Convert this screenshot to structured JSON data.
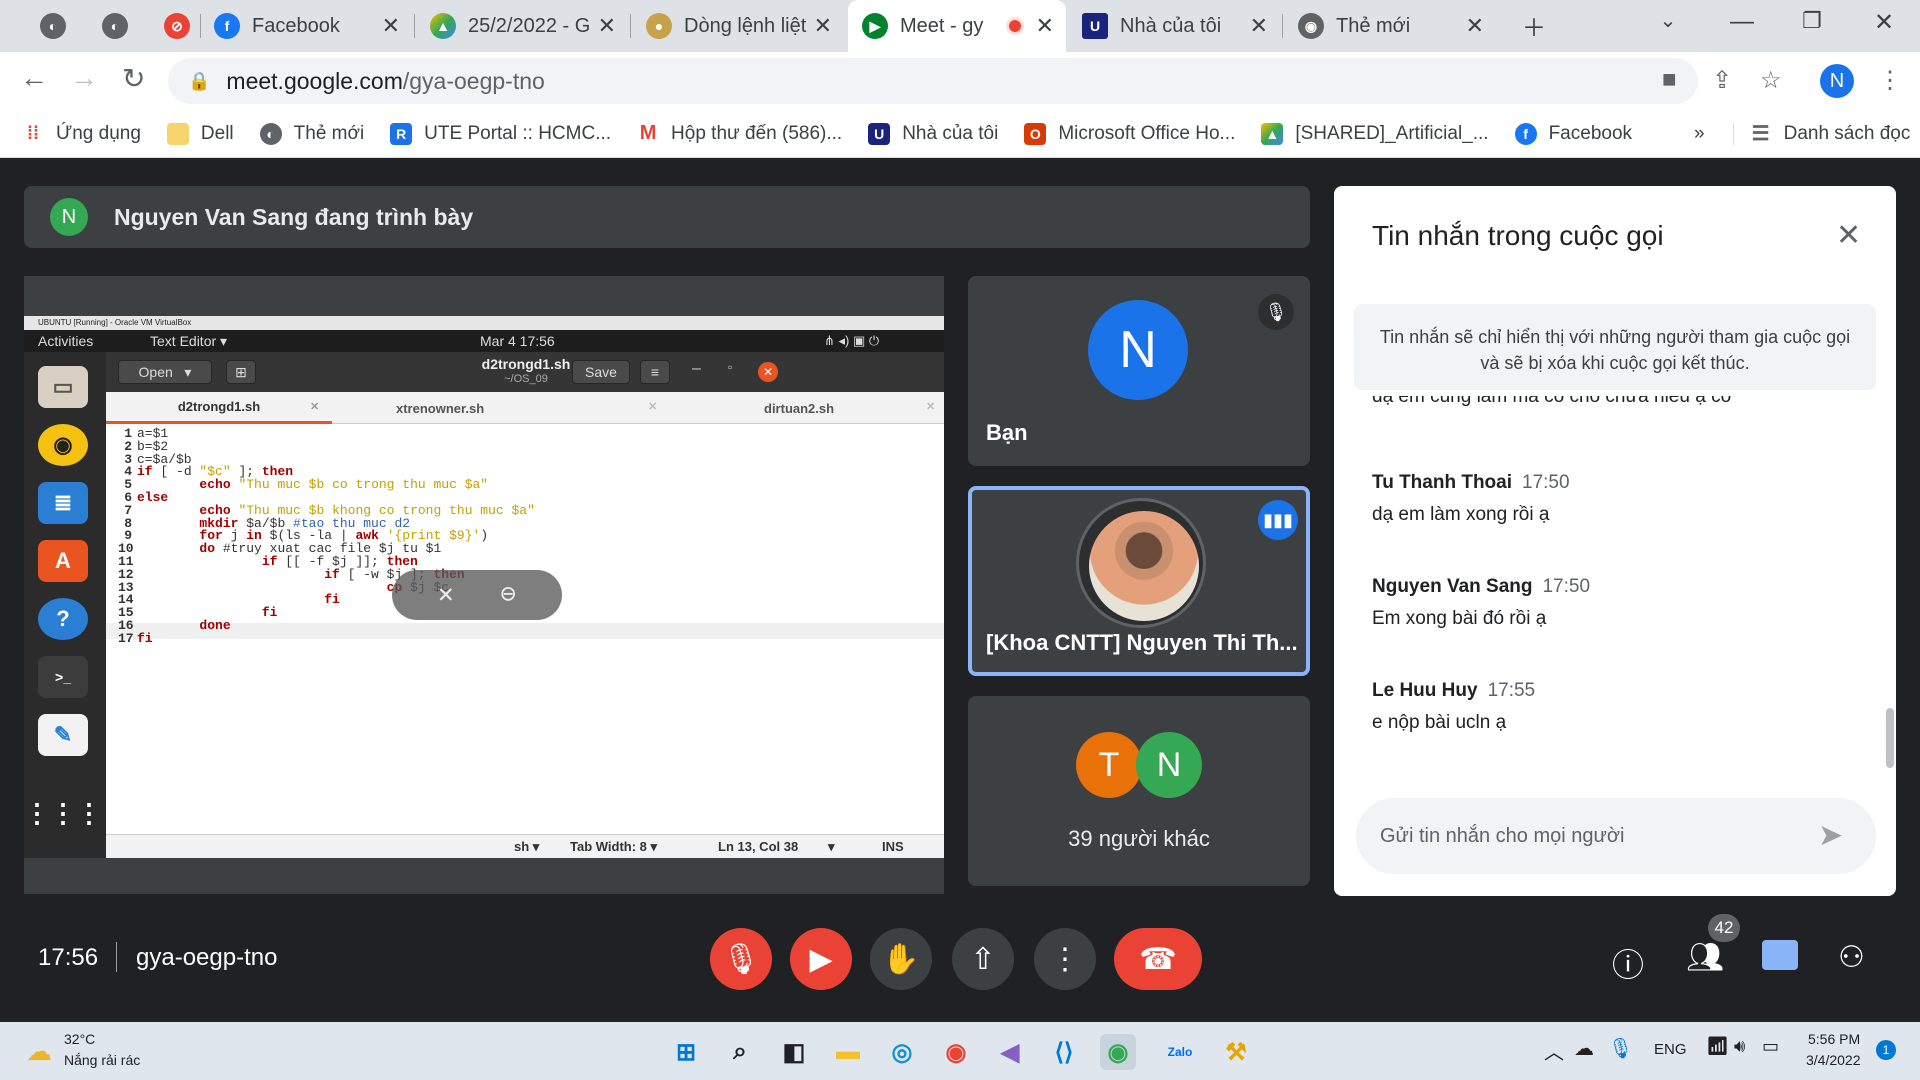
{
  "browser": {
    "tabs": [
      {
        "label": "Facebook",
        "icon": "facebook-icon"
      },
      {
        "label": "25/2/2022 - G",
        "icon": "google-drive-icon"
      },
      {
        "label": "Dòng lệnh liệt",
        "icon": "site-icon"
      },
      {
        "label": "Meet - gy",
        "icon": "google-meet-icon",
        "active": true
      },
      {
        "label": "Nhà của tôi",
        "icon": "uex-icon"
      },
      {
        "label": "Thẻ mới",
        "icon": "chrome-icon"
      }
    ],
    "url_host": "meet.google.com",
    "url_path": "/gya-oegp-tno",
    "profile_initial": "N",
    "bookmarks": [
      {
        "label": "Ứng dụng",
        "icon": "apps-grid-icon"
      },
      {
        "label": "Dell",
        "icon": "folder-icon"
      },
      {
        "label": "Thẻ mới",
        "icon": "globe-icon"
      },
      {
        "label": "UTE Portal :: HCMC...",
        "icon": "ute-icon"
      },
      {
        "label": "Hộp thư đến (586)...",
        "icon": "gmail-icon"
      },
      {
        "label": "Nhà của tôi",
        "icon": "uex-icon"
      },
      {
        "label": "Microsoft Office Ho...",
        "icon": "office-icon"
      },
      {
        "label": "[SHARED]_Artificial_...",
        "icon": "google-drive-icon"
      },
      {
        "label": "Facebook",
        "icon": "facebook-icon"
      }
    ],
    "bookmarks_more": "»",
    "reading_list": "Danh sách đọc"
  },
  "meet": {
    "presenter_initial": "N",
    "presenter_text": "Nguyen Van Sang đang trình bày",
    "participants": {
      "you_initial": "N",
      "you_label": "Bạn",
      "speaker_label": "[Khoa CNTT] Nguyen Thi Th...",
      "others_initials": [
        "T",
        "N"
      ],
      "others_label": "39 người khác"
    },
    "time": "17:56",
    "meeting_code": "gya-oegp-tno",
    "people_count": "42"
  },
  "vm": {
    "window_title": "UBUNTU [Running] - Oracle VM VirtualBox",
    "activities": "Activities",
    "app_menu": "Text Editor ▾",
    "clock": "Mar 4  17:56",
    "open_label": "Open",
    "file_title": "d2trongd1.sh",
    "file_path": "~/OS_09",
    "save_label": "Save",
    "tabs": [
      "d2trongd1.sh",
      "xtrenowner.sh",
      "dirtuan2.sh"
    ],
    "code_lines": [
      "a=$1",
      "b=$2",
      "c=$a/$b",
      "if [ -d \"$c\" ]; then",
      "        echo \"Thu muc $b co trong thu muc $a\"",
      "else",
      "        echo \"Thu muc $b khong co trong thu muc $a\"",
      "        mkdir $a/$b #tao thu muc d2",
      "        for j in $(ls -la | awk '{print $9}')",
      "        do #truy xuat cac file $j tu $1",
      "                if [[ -f $j ]]; then",
      "                        if [ -w $j ]; then",
      "                                cp $j $c",
      "                        fi",
      "                fi",
      "        done",
      "fi"
    ],
    "status_lang": "sh ▾",
    "status_tab": "Tab Width: 8 ▾",
    "status_pos": "Ln 13, Col 38",
    "status_mode": "INS"
  },
  "chat": {
    "title": "Tin nhắn trong cuộc gọi",
    "note": "Tin nhắn sẽ chỉ hiển thị với những người tham gia cuộc gọi và sẽ bị xóa khi cuộc gọi kết thúc.",
    "partial_message": "dạ em cũng làm mà cô cho chưa hiểu ạ cô",
    "messages": [
      {
        "name": "Tu Thanh Thoai",
        "time": "17:50",
        "text": "dạ em làm xong rồi ạ"
      },
      {
        "name": "Nguyen Van Sang",
        "time": "17:50",
        "text": "Em xong bài đó rồi ạ"
      },
      {
        "name": "Le Huu Huy",
        "time": "17:55",
        "text": "e nộp bài ucln ạ"
      }
    ],
    "input_placeholder": "Gửi tin nhắn cho mọi người"
  },
  "taskbar": {
    "weather_temp": "32°C",
    "weather_desc": "Nắng rải rác",
    "lang": "ENG",
    "time": "5:56 PM",
    "date": "3/4/2022",
    "notification_count": "1"
  },
  "colors": {
    "meet_bg": "#202124",
    "tile": "#3c4043",
    "accent_blue": "#1a73e8",
    "red": "#ea4335"
  }
}
